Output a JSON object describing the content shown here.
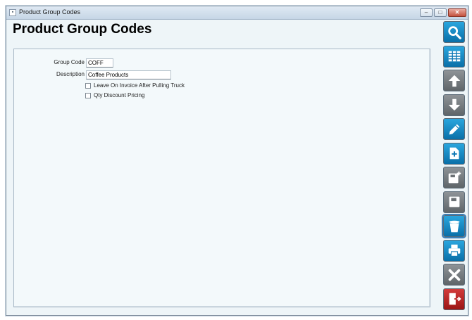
{
  "window": {
    "title": "Product Group Codes",
    "min_label": "–",
    "max_label": "□",
    "close_label": "✕",
    "app_icon": "▪"
  },
  "page": {
    "title": "Product Group Codes"
  },
  "form": {
    "group_code_label": "Group Code",
    "group_code_value": "COFF",
    "description_label": "Description",
    "description_value": "Coffee Products",
    "checkboxes": [
      {
        "label": "Leave On Invoice After Pulling Truck",
        "checked": false
      },
      {
        "label": "Qty Discount Pricing",
        "checked": false
      }
    ]
  },
  "toolbar": {
    "buttons": [
      {
        "icon": "search-icon",
        "color": "#0f79b5"
      },
      {
        "icon": "grid-icon",
        "color": "#0f79b5"
      },
      {
        "icon": "arrow-up-icon",
        "color": "#6b7074"
      },
      {
        "icon": "arrow-down-icon",
        "color": "#6b7074"
      },
      {
        "icon": "edit-pencil-icon",
        "color": "#0f79b5"
      },
      {
        "icon": "new-document-icon",
        "color": "#0f79b5"
      },
      {
        "icon": "save-new-icon",
        "color": "#6b7074"
      },
      {
        "icon": "save-icon",
        "color": "#6b7074"
      },
      {
        "icon": "trash-icon",
        "color": "#0f79b5"
      },
      {
        "icon": "printer-icon",
        "color": "#0f79b5"
      },
      {
        "icon": "cancel-x-icon",
        "color": "#6b7074"
      },
      {
        "icon": "exit-door-icon",
        "color": "#b81e1e"
      }
    ]
  }
}
